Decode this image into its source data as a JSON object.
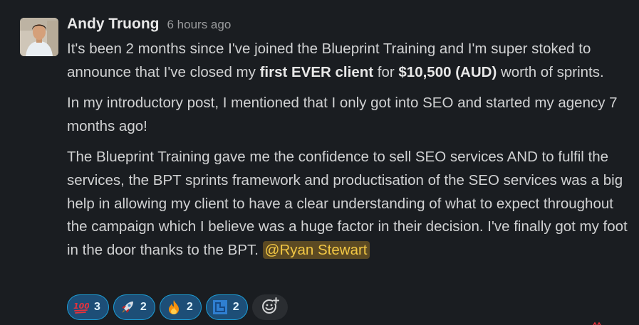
{
  "message": {
    "author": "Andy Truong",
    "timestamp": "6 hours ago",
    "paragraph1": {
      "part1": "It's been 2 months since I've joined the Blueprint Training and I'm super stoked to announce that I've closed my ",
      "bold1": "first EVER client",
      "part2": " for ",
      "bold2": "$10,500 (AUD)",
      "part3": " worth of sprints."
    },
    "paragraph2": "In my introductory post, I mentioned that I only got into SEO and started my agency 7 months ago!",
    "paragraph3": {
      "text": "The Blueprint Training gave me the confidence to sell SEO services AND to fulfil the services, the BPT sprints framework and productisation of the SEO services was a big help in allowing my client to have a clear understanding of what to expect throughout the campaign which I believe was a huge factor in their decision. I've finally got my foot in the door thanks to the BPT. ",
      "mention": "@Ryan Stewart"
    }
  },
  "reactions": [
    {
      "icon": "hundred-points-icon",
      "count": "3"
    },
    {
      "icon": "rocket-icon",
      "count": "2"
    },
    {
      "icon": "fire-icon",
      "count": "2"
    },
    {
      "icon": "bpt-logo-icon",
      "count": "2"
    }
  ],
  "add_reaction_icon": "add-reaction-icon",
  "colors": {
    "background": "#1a1d21",
    "reaction_bg": "#1d4e77",
    "reaction_border": "#1d9bd1",
    "mention_bg": "#5c4a23",
    "mention_text": "#f2c744"
  }
}
